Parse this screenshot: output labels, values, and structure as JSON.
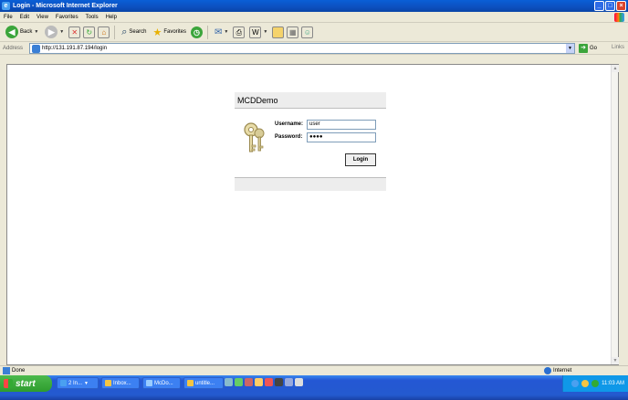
{
  "window": {
    "title": "Login - Microsoft Internet Explorer"
  },
  "menu": {
    "items": [
      "File",
      "Edit",
      "View",
      "Favorites",
      "Tools",
      "Help"
    ]
  },
  "toolbar": {
    "back": "Back",
    "search": "Search",
    "favorites": "Favorites"
  },
  "address": {
    "label": "Address",
    "url": "http://131.191.87.194/login",
    "go": "Go",
    "links": "Links"
  },
  "page": {
    "heading": "MCDDemo",
    "username_label": "Username:",
    "username_value": "user",
    "password_label": "Password:",
    "password_value": "●●●●",
    "login_button": "Login"
  },
  "status": {
    "text": "Done",
    "zone": "Internet"
  },
  "taskbar": {
    "start": "start",
    "tasks": [
      "2 In...",
      "Inbox...",
      "McDo...",
      "untitle..."
    ],
    "clock": "11:03 AM"
  }
}
